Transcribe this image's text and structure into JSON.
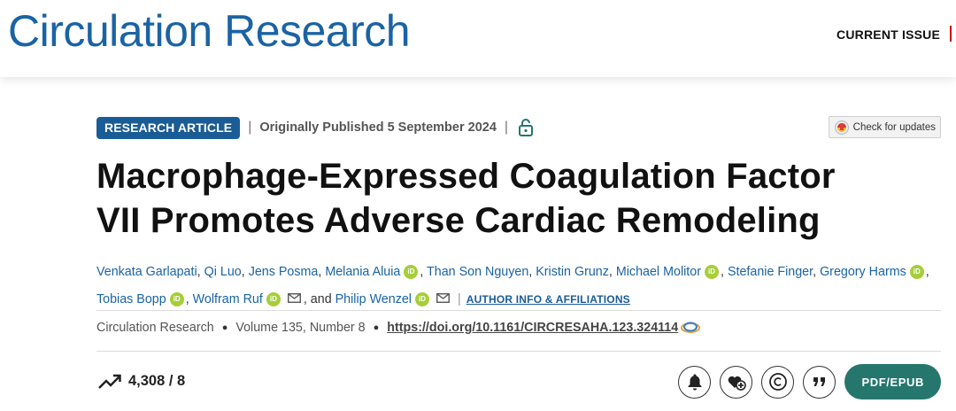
{
  "header": {
    "journal_name": "Circulation Research",
    "nav_current_issue": "CURRENT ISSUE"
  },
  "article": {
    "type_badge": "RESEARCH ARTICLE",
    "published": "Originally Published 5 September 2024",
    "access_icon": "open-lock-icon",
    "check_updates": "Check for updates",
    "title_line1": "Macrophage-Expressed Coagulation Factor",
    "title_line2": "VII Promotes Adverse Cardiac Remodeling",
    "authors": [
      "Venkata Garlapati",
      "Qi Luo",
      "Jens Posma",
      "Melania Aluia",
      "Than Son Nguyen",
      "Kristin Grunz",
      "Michael Molitor",
      "Stefanie Finger",
      "Gregory Harms",
      "Tobias Bopp",
      "Wolfram Ruf",
      "Philip Wenzel"
    ],
    "author_sep": ", ",
    "and_text": ", and ",
    "orcid_label": "iD",
    "affiliations_link": "AUTHOR INFO & AFFILIATIONS",
    "citation": {
      "journal": "Circulation Research",
      "volume": "Volume 135, Number 8",
      "doi": "https://doi.org/10.1161/CIRCRESAHA.123.324114"
    },
    "metrics": "4,308 / 8",
    "pdf_button": "PDF/EPUB"
  },
  "colors": {
    "brand_blue": "#1a63a5",
    "badge_blue": "#1a5c96",
    "orcid_green": "#a6ce39",
    "pdf_teal": "#25766d"
  },
  "icons": [
    "trending-up-icon",
    "bell-icon",
    "heart-plus-icon",
    "copyright-icon",
    "quote-icon",
    "email-icon",
    "crossref-icon"
  ]
}
